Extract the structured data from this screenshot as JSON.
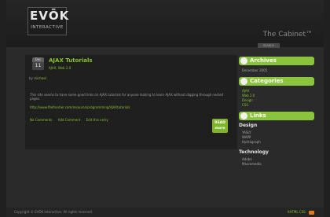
{
  "header": {
    "logo_main": "EVŌK",
    "logo_sub": "INTERACTIVE",
    "site_title": "The Cabinet™",
    "search_label": "SEARCH"
  },
  "post": {
    "date_month": "Dec",
    "date_day": "11",
    "title": "AJAX Tutorials",
    "categories": "AJAX, Web 2.0",
    "by_prefix": "by",
    "author": "michael",
    "body": "This site seems to have some good links on AJAX tutorials for anyone looking to learn AJAX without digging through nested pages.",
    "link": "http://www.filefrontier.com/resource/programming/AJAXtutorials",
    "actions": [
      "No Comments",
      "Add Comment",
      "Edit this entry"
    ],
    "read_more_line1": "READ",
    "read_more_line2": "more"
  },
  "sidebar": {
    "archives": {
      "title": "Archives",
      "items": [
        "December 2005"
      ]
    },
    "categories": {
      "title": "Categories",
      "items": [
        "AJAX",
        "Web 2.0",
        "Design",
        "CSS"
      ]
    },
    "links": {
      "title": "Links",
      "groups": [
        {
          "name": "Design",
          "items": [
            "YASLY",
            "WAPP",
            "Hydragraph"
          ]
        },
        {
          "name": "Technology",
          "items": [
            "Adobe",
            "Macromedia"
          ]
        }
      ]
    }
  },
  "footer": {
    "copyright": "Copyright © EVŌK Interactive. All rights reserved.",
    "links": "XHTML CSS"
  }
}
